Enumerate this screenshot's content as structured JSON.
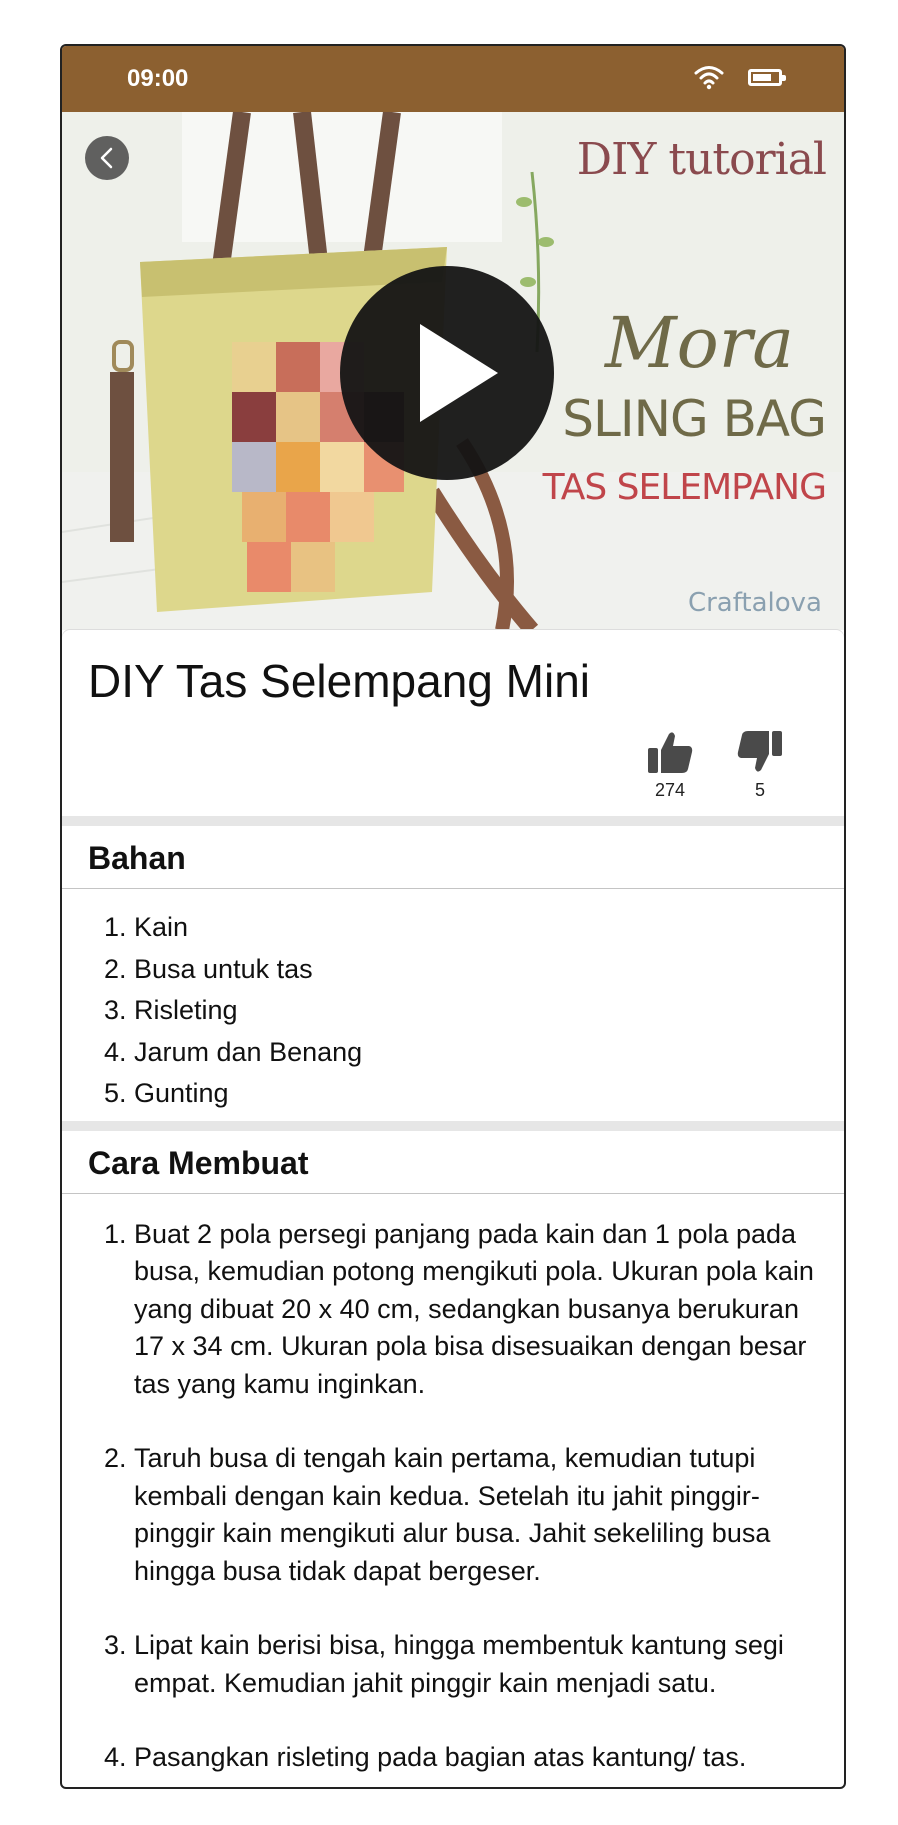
{
  "status_bar": {
    "time": "09:00",
    "icons": [
      "wifi-icon",
      "battery-icon"
    ]
  },
  "hero": {
    "title_line": "DIY tutorial",
    "script_word": "Mora",
    "headline": "SLING BAG",
    "subheadline": "TAS SELEMPANG",
    "brand": "Craftalova",
    "icons": [
      "back-icon",
      "play-icon"
    ]
  },
  "article": {
    "title": "DIY Tas Selempang Mini",
    "likes": "274",
    "dislikes": "5"
  },
  "bahan": {
    "heading": "Bahan",
    "items": [
      "Kain",
      "Busa untuk tas",
      "Risleting",
      "Jarum dan Benang",
      "Gunting"
    ]
  },
  "cara": {
    "heading": "Cara Membuat",
    "steps": [
      "Buat 2 pola persegi panjang pada kain dan 1 pola pada busa, kemudian potong mengikuti pola. Ukuran pola kain yang dibuat 20 x 40 cm, sedangkan busanya berukuran 17 x 34 cm. Ukuran pola bisa disesuaikan dengan besar tas yang kamu inginkan.",
      "Taruh busa di tengah kain pertama, kemudian tutupi kembali dengan kain kedua. Setelah itu jahit pinggir-pinggir kain mengikuti alur busa. Jahit sekeliling busa hingga busa tidak dapat bergeser.",
      "Lipat kain berisi bisa, hingga membentuk kantung segi empat. Kemudian jahit pinggir kain menjadi satu.",
      "Pasangkan risleting pada bagian atas kantung/ tas."
    ]
  },
  "colors": {
    "status_bar": "#8c6030",
    "separator": "#e6e6e6"
  }
}
